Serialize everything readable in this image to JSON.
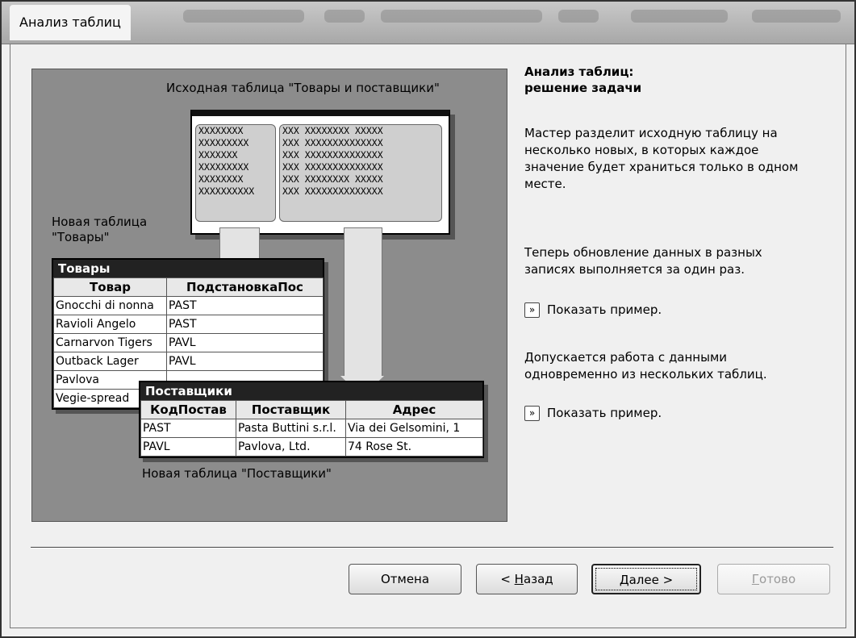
{
  "window": {
    "title": "Анализ таблиц"
  },
  "illustration": {
    "source_caption": "Исходная таблица \"Товары и поставщики\"",
    "source_rows_left": [
      "XXXXXXXX",
      "XXXXXXXXX",
      "XXXXXXX",
      "XXXXXXXXX",
      "XXXXXXXX",
      "XXXXXXXXXX"
    ],
    "source_rows_right": [
      "XXX XXXXXXXX XXXXX",
      "XXX XXXXXXXXXXXXXX",
      "XXX XXXXXXXXXXXXXX",
      "XXX XXXXXXXXXXXXXX",
      "XXX XXXXXXXX XXXXX",
      "XXX XXXXXXXXXXXXXX"
    ],
    "new_goods_caption_line1": "Новая таблица",
    "new_goods_caption_line2": "\"Товары\"",
    "goods_table": {
      "title": "Товары",
      "headers": [
        "Товар",
        "ПодстановкаПос"
      ],
      "rows": [
        [
          "Gnocchi di nonna",
          "PAST"
        ],
        [
          "Ravioli Angelo",
          "PAST"
        ],
        [
          "Carnarvon Tigers",
          "PAVL"
        ],
        [
          "Outback Lager",
          "PAVL"
        ],
        [
          "Pavlova",
          ""
        ],
        [
          "Vegie-spread",
          ""
        ]
      ]
    },
    "suppliers_table": {
      "title": "Поставщики",
      "headers": [
        "КодПостав",
        "Поставщик",
        "Адрес"
      ],
      "rows": [
        [
          "PAST",
          "Pasta Buttini s.r.l.",
          "Via dei Gelsomini, 1"
        ],
        [
          "PAVL",
          "Pavlova, Ltd.",
          "74 Rose St."
        ]
      ]
    },
    "new_suppliers_caption": "Новая таблица \"Поставщики\""
  },
  "info": {
    "heading_line1": "Анализ таблиц:",
    "heading_line2": "решение задачи",
    "paragraph1": [
      "Мастер разделит исходную таблицу на",
      "несколько новых, в которых каждое",
      "значение будет храниться только в одном",
      "месте."
    ],
    "paragraph2": [
      "Теперь обновление данных в разных",
      "записях выполняется за один раз."
    ],
    "show_example_1": "Показать пример.",
    "paragraph3": [
      "Допускается работа с данными",
      "одновременно из нескольких таблиц."
    ],
    "show_example_2": "Показать пример.",
    "show_example_icon": "»"
  },
  "buttons": {
    "cancel": "Отмена",
    "back_prefix": "< ",
    "back_mnemonic": "Н",
    "back_rest": "азад",
    "next_mnemonic": "Д",
    "next_rest": "алее >",
    "finish_mnemonic": "Г",
    "finish_rest": "отово"
  }
}
